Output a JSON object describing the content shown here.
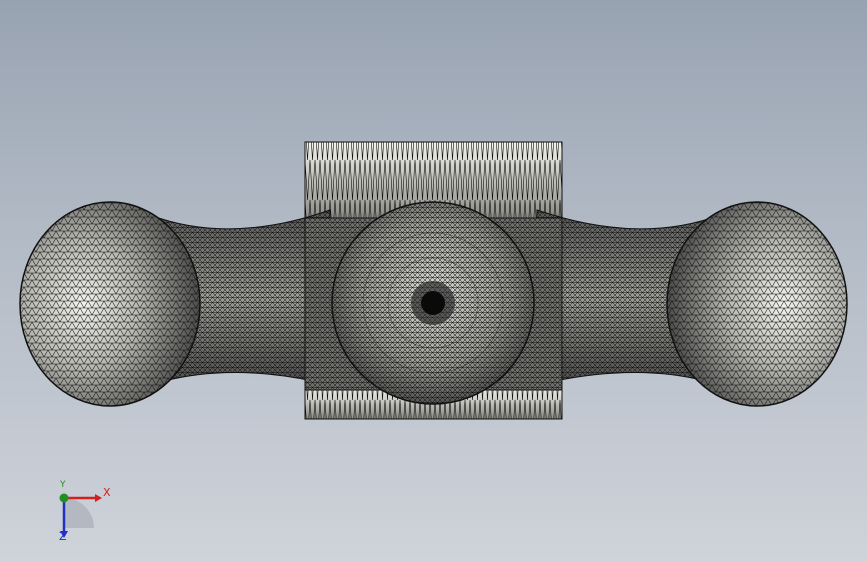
{
  "window": {
    "view": "3d-mesh-viewport"
  },
  "model": {
    "name": "mesh-model",
    "mesh_color": "#1a1a1a",
    "surface_light": "#e8e8e4",
    "surface_dark": "#2a2a2a"
  },
  "triad": {
    "x_label": "X",
    "y_label": "Y",
    "z_label": "Z",
    "x_color": "#d02020",
    "y_color": "#209020",
    "z_color": "#2030c0"
  },
  "icons": [
    "coordinate-triad-icon"
  ]
}
